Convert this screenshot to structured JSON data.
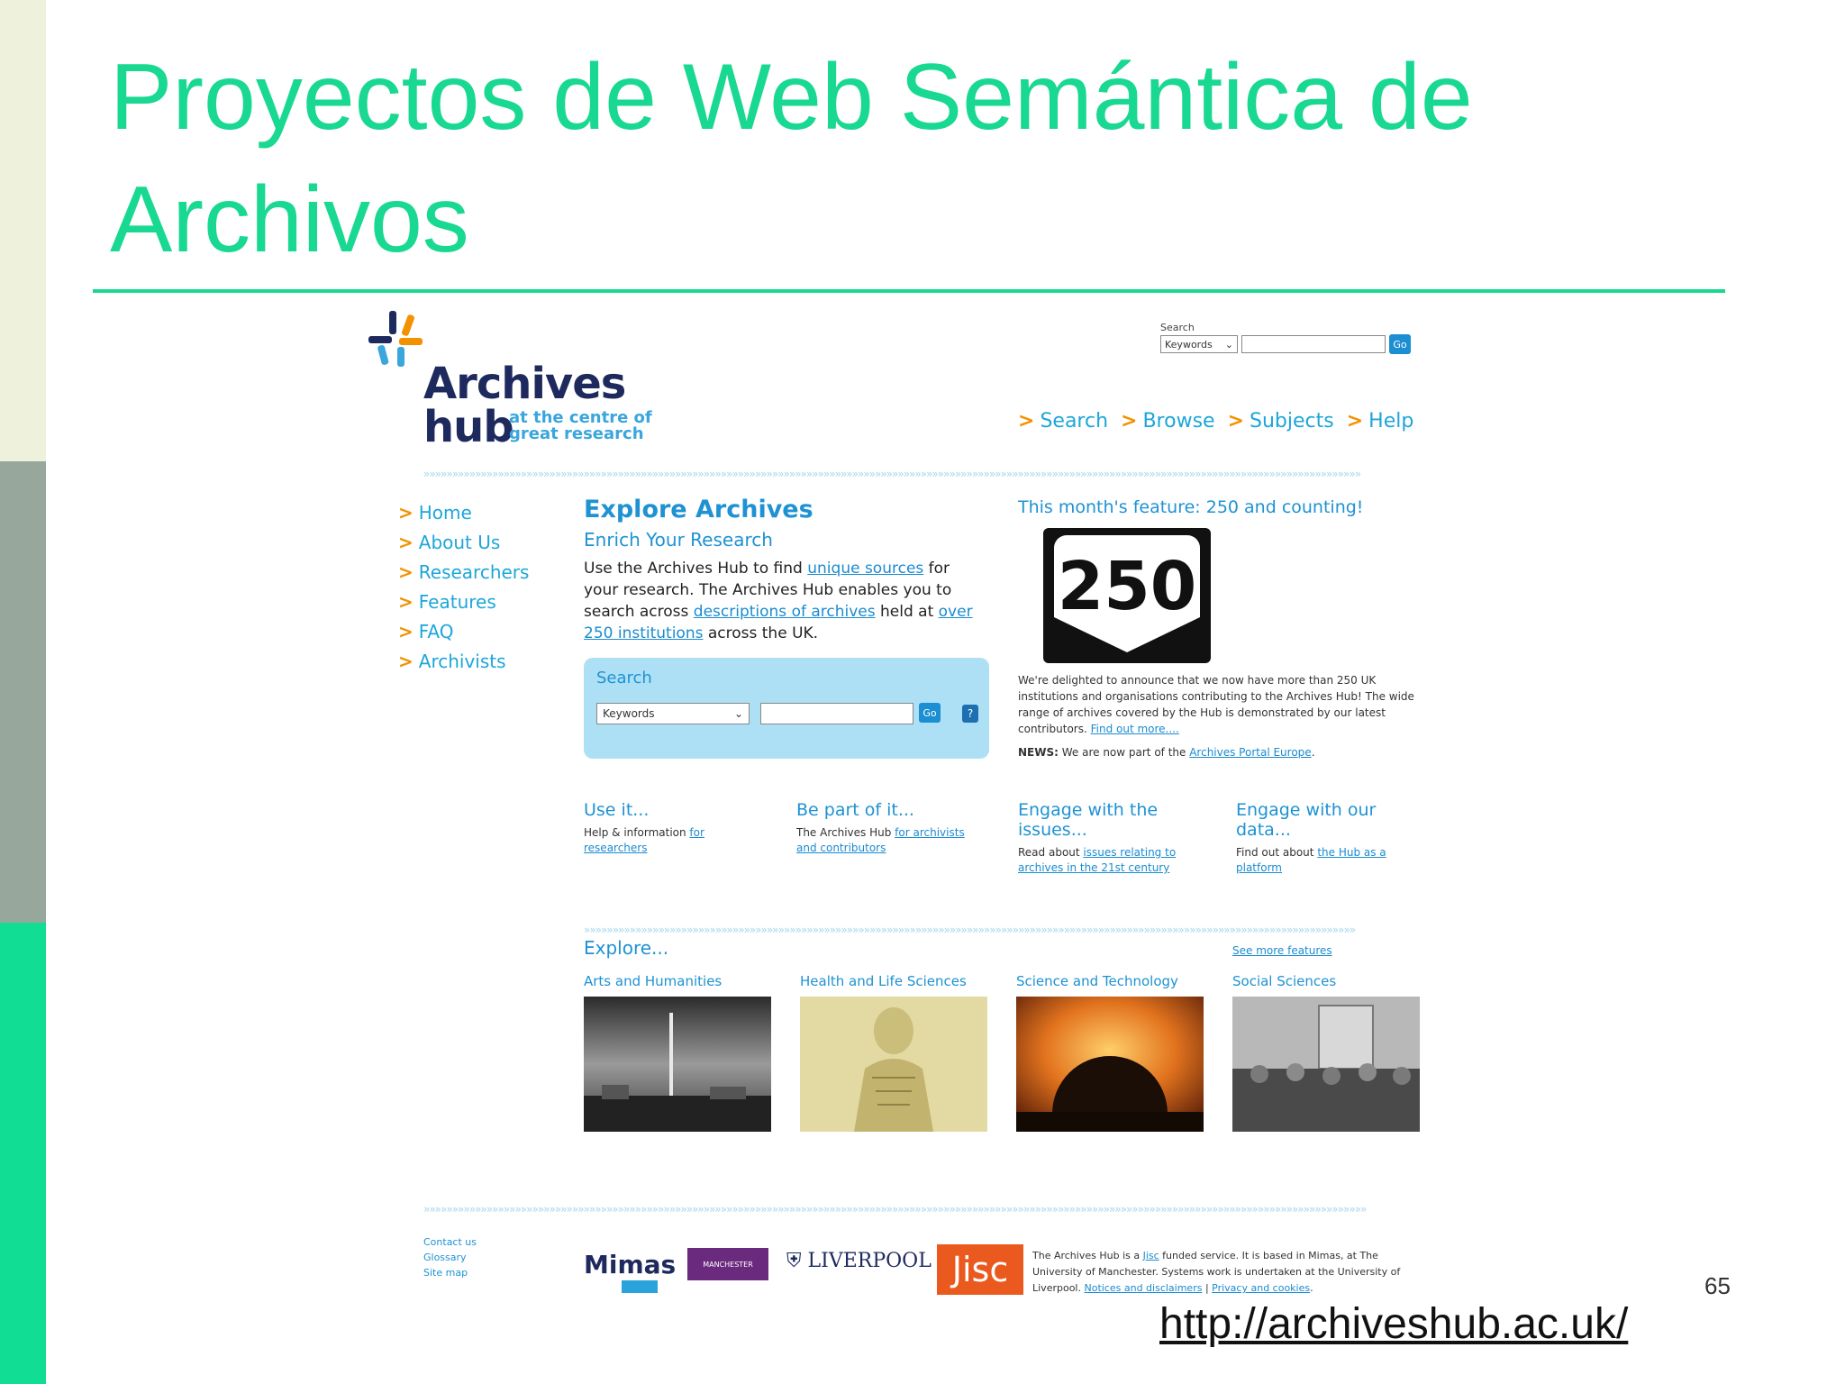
{
  "slide": {
    "title": "Proyectos de Web Semántica de Archivos",
    "page_number": "65",
    "url": "http://archiveshub.ac.uk/"
  },
  "site": {
    "logo": {
      "name_line1": "Archives",
      "name_line2": "hub",
      "tagline_line1": "at the centre of",
      "tagline_line2": "great research",
      "colors": [
        "#1e2a5e",
        "#3aa6dc",
        "#f29200"
      ]
    },
    "top_search": {
      "label": "Search",
      "select_value": "Keywords",
      "go": "Go"
    },
    "top_nav": [
      "Search",
      "Browse",
      "Subjects",
      "Help"
    ],
    "left_nav": [
      "Home",
      "About Us",
      "Researchers",
      "Features",
      "FAQ",
      "Archivists"
    ],
    "explore": {
      "title": "Explore Archives",
      "subtitle": "Enrich Your Research",
      "intro": {
        "t1": "Use the Archives Hub to find ",
        "l1": "unique sources",
        "t2": " for your research. The Archives Hub enables you to search across ",
        "l2": "descriptions of archives",
        "t3": " held at ",
        "l3": "over 250 institutions",
        "t4": " across the UK."
      }
    },
    "search_box": {
      "label": "Search",
      "select_value": "Keywords",
      "go": "Go",
      "help": "?"
    },
    "feature": {
      "title": "This month's feature: 250 and counting!",
      "badge": "250",
      "text": "We're delighted to announce that we now have more than 250 UK institutions and organisations contributing to the Archives Hub! The wide range of archives covered by the Hub is demonstrated by our latest contributors. ",
      "link": "Find out more....",
      "news_label": "NEWS:",
      "news_text": " We are now part of the ",
      "news_link": "Archives Portal Europe",
      "news_end": "."
    },
    "columns": [
      {
        "heading": "Use it...",
        "text": "Help & information ",
        "link": "for researchers"
      },
      {
        "heading": "Be part of it...",
        "text": "The Archives Hub ",
        "link": "for archivists and contributors"
      },
      {
        "heading": "Engage with the issues...",
        "text": "Read about ",
        "link": "issues relating to archives in the 21st century"
      },
      {
        "heading": "Engage with our data...",
        "text": "Find out about ",
        "link": "the Hub as a platform"
      }
    ],
    "explore_section": {
      "heading": "Explore...",
      "see_more": "See more features",
      "categories": [
        "Arts and Humanities",
        "Health and Life Sciences",
        "Science and Technology",
        "Social Sciences"
      ]
    },
    "footer": {
      "links": [
        "Contact us",
        "Glossary",
        "Site map"
      ],
      "logos": {
        "mimas": "Mimas",
        "manchester": "MANCHESTER",
        "liverpool": "LIVERPOOL",
        "jisc": "Jisc"
      },
      "text": {
        "t1": "The Archives Hub is a ",
        "l1": "Jisc",
        "t2": " funded service. It is based in Mimas, at The University of Manchester. Systems work is undertaken at the University of Liverpool. ",
        "l2": "Notices and disclaimers",
        "sep": " | ",
        "l3": "Privacy and cookies",
        "end": "."
      }
    }
  }
}
